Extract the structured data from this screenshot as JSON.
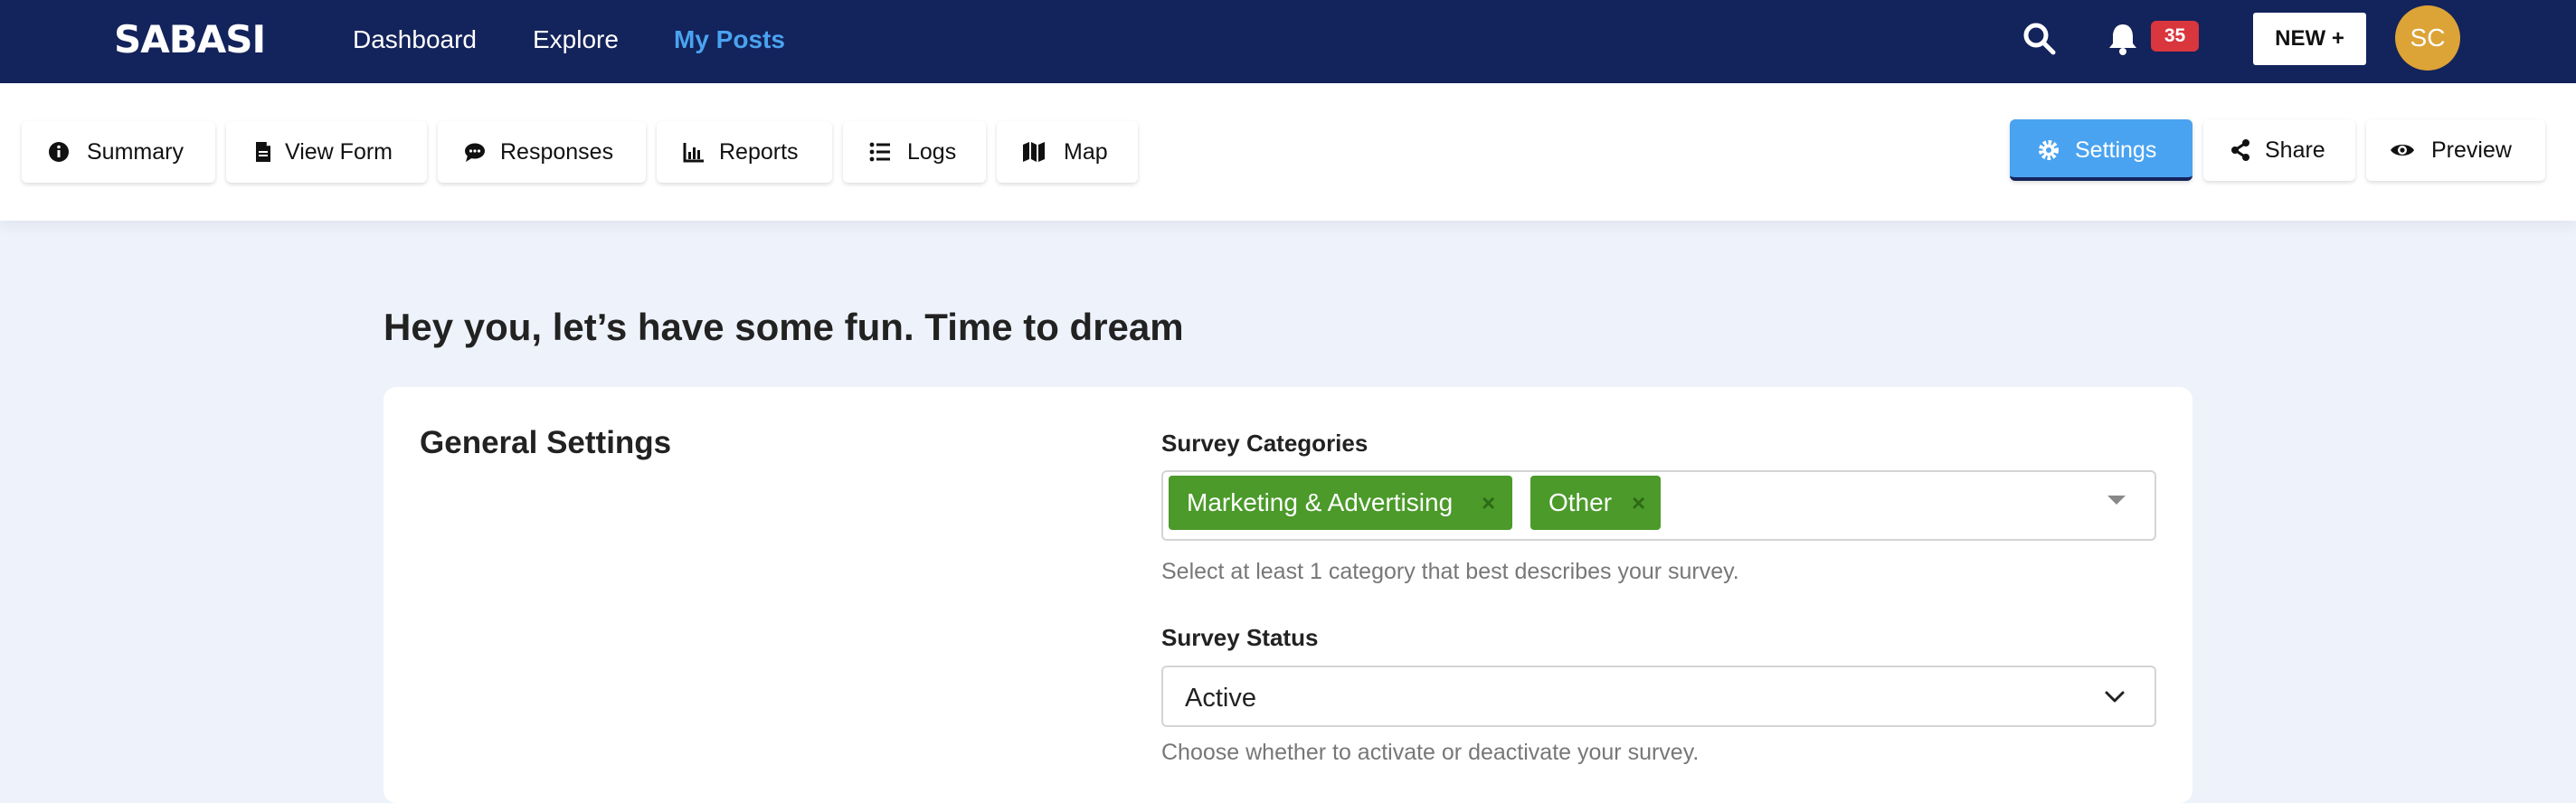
{
  "brand": {
    "logo_text": "SABASI"
  },
  "nav": {
    "links": [
      {
        "label": "Dashboard"
      },
      {
        "label": "Explore"
      },
      {
        "label": "My Posts"
      }
    ],
    "notifications_count": "35",
    "new_button": "NEW +",
    "avatar_initials": "SC"
  },
  "tabs": [
    {
      "label": "Summary",
      "icon": "info-circle-icon"
    },
    {
      "label": "View Form",
      "icon": "file-icon"
    },
    {
      "label": "Responses",
      "icon": "comment-icon"
    },
    {
      "label": "Reports",
      "icon": "bar-chart-icon"
    },
    {
      "label": "Logs",
      "icon": "list-icon"
    },
    {
      "label": "Map",
      "icon": "map-icon"
    }
  ],
  "actions": [
    {
      "label": "Settings",
      "icon": "gear-icon"
    },
    {
      "label": "Share",
      "icon": "share-icon"
    },
    {
      "label": "Preview",
      "icon": "eye-icon"
    }
  ],
  "main": {
    "heading": "Hey you, let’s have some fun. Time to dream",
    "card_title": "General Settings",
    "categories": {
      "label": "Survey Categories",
      "selected": [
        "Marketing & Advertising",
        "Other"
      ],
      "help": "Select at least 1 category that best describes your survey."
    },
    "status": {
      "label": "Survey Status",
      "value": "Active",
      "help": "Choose whether to activate or deactivate your survey."
    }
  },
  "colors": {
    "navbar": "#13235b",
    "accent_blue": "#4aa3f0",
    "chip_green": "#4b9a2a",
    "badge_red": "#d9363e",
    "avatar": "#dca336",
    "page_bg": "#eef2fa"
  }
}
